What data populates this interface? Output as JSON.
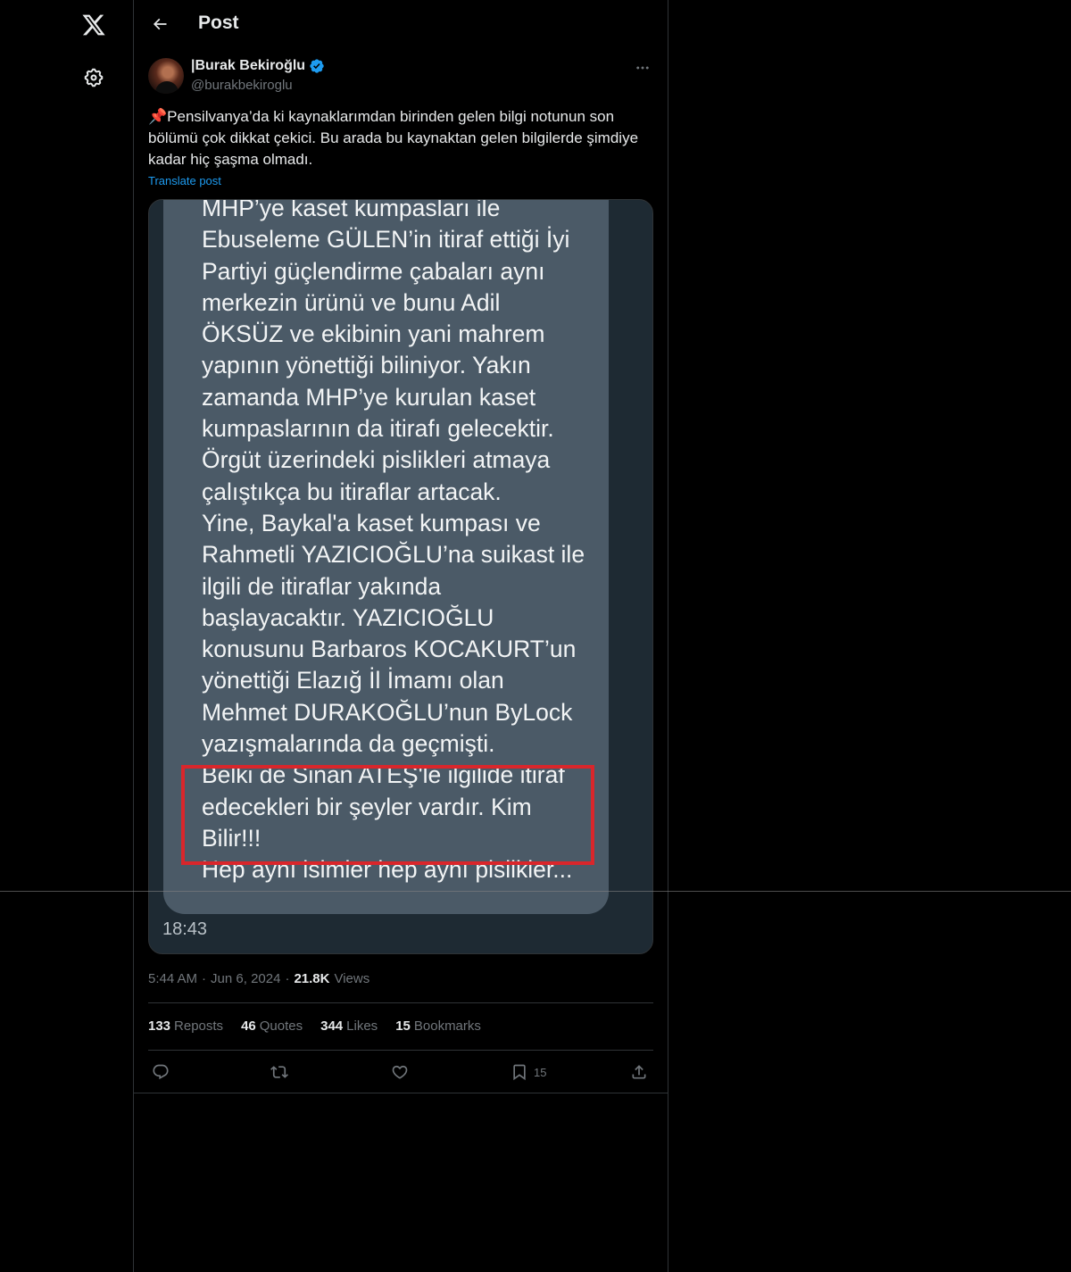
{
  "nav": {
    "logo_icon": "x-logo-icon",
    "settings_icon": "gear-icon"
  },
  "header": {
    "title": "Post",
    "back_icon": "arrow-left-icon"
  },
  "post": {
    "author_name": "|Burak Bekiroğlu",
    "author_handle": "@burakbekiroglu",
    "verified": true,
    "text": "📌Pensilvanya’da ki kaynaklarımdan birinden gelen bilgi notunun son bölümü çok dikkat çekici. Bu arada bu kaynaktan gelen bilgilerde şimdiye kadar hiç şaşma olmadı.",
    "translate_label": "Translate post",
    "image": {
      "message_text": "MHP’ye kaset kumpasları ile\nEbuseleme GÜLEN’in itiraf ettiği İyi\nPartiyi güçlendirme çabaları aynı\nmerkezin ürünü ve bunu Adil\nÖKSÜZ ve ekibinin yani mahrem\nyapının yönettiği biliniyor. Yakın\nzamanda MHP’ye kurulan kaset\nkumpaslarının da itirafı gelecektir.\nÖrgüt üzerindeki pislikleri atmaya\nçalıştıkça bu itiraflar artacak.\nYine, Baykal'a kaset kumpası ve\nRahmetli YAZICIOĞLU’na suikast ile\nilgili de itiraflar yakında\nbaşlayacaktır. YAZICIOĞLU\nkonusunu Barbaros KOCAKURT’un\nyönettiği Elazığ İl İmamı olan\nMehmet DURAKOĞLU’nun ByLock\nyazışmalarında da geçmişti.\nBelki de Sinan ATEŞ'le ilgilide itiraf\nedecekleri bir şeyler vardır. Kim\nBilir!!!\nHep aynı isimler hep aynı pislikler...",
      "time": "18:43",
      "highlight_color": "#d9262b"
    },
    "time": "5:44 AM",
    "date": "Jun 6, 2024",
    "views_count": "21.8K",
    "views_label": "Views",
    "separator": "·"
  },
  "stats": [
    {
      "count": "133",
      "label": "Reposts"
    },
    {
      "count": "46",
      "label": "Quotes"
    },
    {
      "count": "344",
      "label": "Likes"
    },
    {
      "count": "15",
      "label": "Bookmarks"
    }
  ],
  "actions": {
    "reply_icon": "reply-icon",
    "repost_icon": "repost-icon",
    "like_icon": "heart-icon",
    "bookmark_icon": "bookmark-icon",
    "bookmark_count": "15",
    "share_icon": "share-icon"
  },
  "colors": {
    "background": "#000000",
    "accent": "#1d9bf0",
    "muted": "#71767b",
    "border": "#2f3336"
  }
}
